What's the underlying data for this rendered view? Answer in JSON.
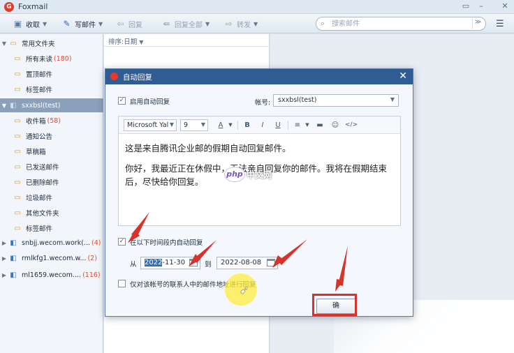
{
  "app": {
    "title": "Foxmail"
  },
  "toolbar": {
    "receive": "收取",
    "compose": "写邮件",
    "reply": "回复",
    "reply_all": "回复全部",
    "forward": "转发",
    "search_placeholder": "搜索邮件"
  },
  "sidebar": {
    "common_folders": "常用文件夹",
    "all_unread": "所有未读",
    "all_unread_count": "(180)",
    "pinned": "置顶邮件",
    "tagged": "标签邮件",
    "account": "sxxbsl(test)",
    "inbox": "收件箱",
    "inbox_count": "(58)",
    "notices": "通知公告",
    "drafts": "草稿箱",
    "sent": "已发送邮件",
    "deleted": "已删除邮件",
    "junk": "垃圾邮件",
    "other": "其他文件夹",
    "account_tagged": "标签邮件",
    "accounts": [
      {
        "name": "snbjj.wecom.work(...",
        "count": "(4)"
      },
      {
        "name": "rmlkfg1.wecom.w...",
        "count": "(2)"
      },
      {
        "name": "ml1659.wecom....",
        "count": "(116)"
      }
    ]
  },
  "list": {
    "sort_label": "排序:日期"
  },
  "dialog": {
    "title": "自动回复",
    "enable_label": "启用自动回复",
    "account_label": "帐号:",
    "account_value": "sxxbsl(test)",
    "font_family": "Microsoft Yal",
    "font_size": "9",
    "body_line1": "这是来自腾讯企业邮的假期自动回复邮件。",
    "body_line2": "你好，我最近正在休假中，无法亲自回复你的邮件。我将在假期结束后，尽快给你回复。",
    "period_label": "在以下时间段内自动回复",
    "from_label": "从",
    "from_date_highlight": "2022",
    "from_date_rest": "-11-30",
    "to_label": "到",
    "to_date": "2022-08-08",
    "contacts_only_label": "仅对该帐号的联系人中的邮件地址进行回复",
    "ok_label": "确"
  },
  "watermark": {
    "text": "中文网"
  },
  "colors": {
    "accent": "#2f5d93",
    "highlight": "#d8332a",
    "count": "#e04a2f"
  }
}
